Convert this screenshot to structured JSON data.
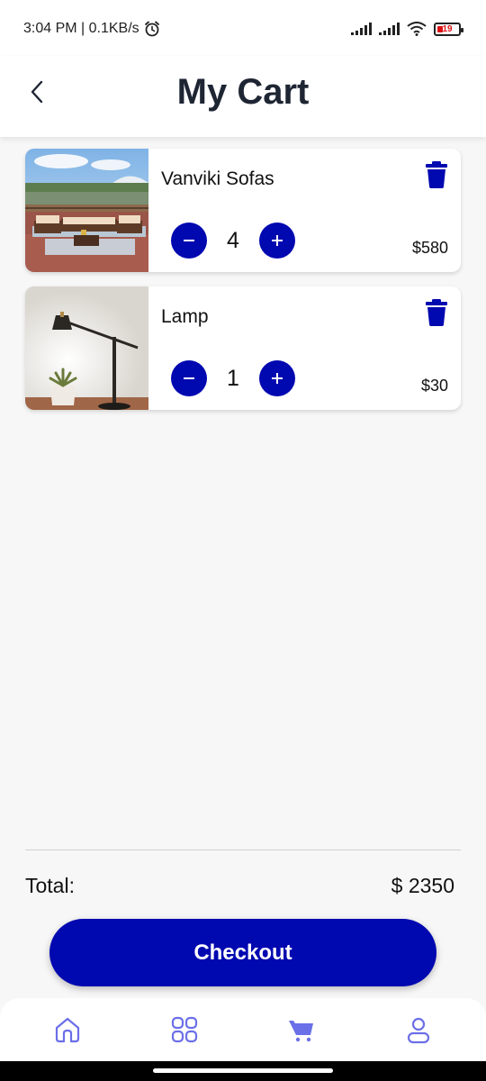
{
  "status_bar": {
    "time_net": "3:04 PM | 0.1KB/s",
    "battery": "19"
  },
  "header": {
    "title": "My Cart"
  },
  "cart": {
    "items": [
      {
        "name": "Vanviki Sofas",
        "quantity": "4",
        "price": "$580",
        "image": "outdoor-sofa-photo"
      },
      {
        "name": "Lamp",
        "quantity": "1",
        "price": "$30",
        "image": "desk-lamp-photo"
      }
    ]
  },
  "summary": {
    "total_label": "Total:",
    "total_value": "$ 2350"
  },
  "checkout": {
    "label": "Checkout"
  },
  "nav": {
    "items": [
      "home-icon",
      "grid-icon",
      "cart-icon",
      "profile-icon"
    ],
    "active": "cart-icon"
  },
  "colors": {
    "accent": "#0008b0",
    "nav_icon": "#6b6fe8"
  }
}
